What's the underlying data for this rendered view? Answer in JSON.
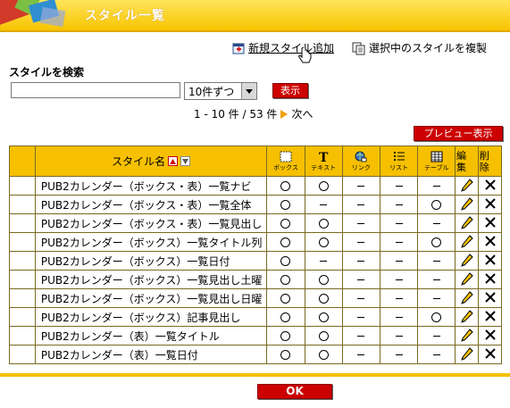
{
  "header": {
    "title": "スタイル一覧"
  },
  "actions": {
    "new_style": "新規スタイル追加",
    "duplicate": "選択中のスタイルを複製"
  },
  "search": {
    "title": "スタイルを検索",
    "value": "",
    "per_page": "10件ずつ",
    "submit": "表示"
  },
  "pager": {
    "range": "1 - 10 件 / 53 件",
    "next": "次へ"
  },
  "preview_button": "プレビュー表示",
  "table": {
    "header": {
      "name": "スタイル名",
      "box": "ボックス",
      "text": "テキスト",
      "link": "リンク",
      "list": "リスト",
      "table": "テーブル",
      "edit": "編集",
      "delete": "削除"
    },
    "rows": [
      {
        "name": "PUB2カレンダー（ボックス・表）一覧ナビ",
        "box": "○",
        "text": "○",
        "link": "－",
        "list": "－",
        "table": "－"
      },
      {
        "name": "PUB2カレンダー（ボックス・表）一覧全体",
        "box": "○",
        "text": "－",
        "link": "－",
        "list": "－",
        "table": "○"
      },
      {
        "name": "PUB2カレンダー（ボックス・表）一覧見出し",
        "box": "○",
        "text": "○",
        "link": "－",
        "list": "－",
        "table": "－"
      },
      {
        "name": "PUB2カレンダー（ボックス）一覧タイトル列",
        "box": "○",
        "text": "○",
        "link": "－",
        "list": "－",
        "table": "○"
      },
      {
        "name": "PUB2カレンダー（ボックス）一覧日付",
        "box": "○",
        "text": "－",
        "link": "－",
        "list": "－",
        "table": "－"
      },
      {
        "name": "PUB2カレンダー（ボックス）一覧見出し土曜",
        "box": "○",
        "text": "○",
        "link": "－",
        "list": "－",
        "table": "－"
      },
      {
        "name": "PUB2カレンダー（ボックス）一覧見出し日曜",
        "box": "○",
        "text": "○",
        "link": "－",
        "list": "－",
        "table": "－"
      },
      {
        "name": "PUB2カレンダー（ボックス）記事見出し",
        "box": "○",
        "text": "○",
        "link": "－",
        "list": "－",
        "table": "○"
      },
      {
        "name": "PUB2カレンダー（表）一覧タイトル",
        "box": "○",
        "text": "○",
        "link": "－",
        "list": "－",
        "table": "－"
      },
      {
        "name": "PUB2カレンダー（表）一覧日付",
        "box": "○",
        "text": "○",
        "link": "－",
        "list": "－",
        "table": "－"
      }
    ]
  },
  "ok_button": "OK",
  "colors": {
    "header": "#f7c400",
    "button": "#cc0000",
    "table_head": "#f6c000"
  }
}
